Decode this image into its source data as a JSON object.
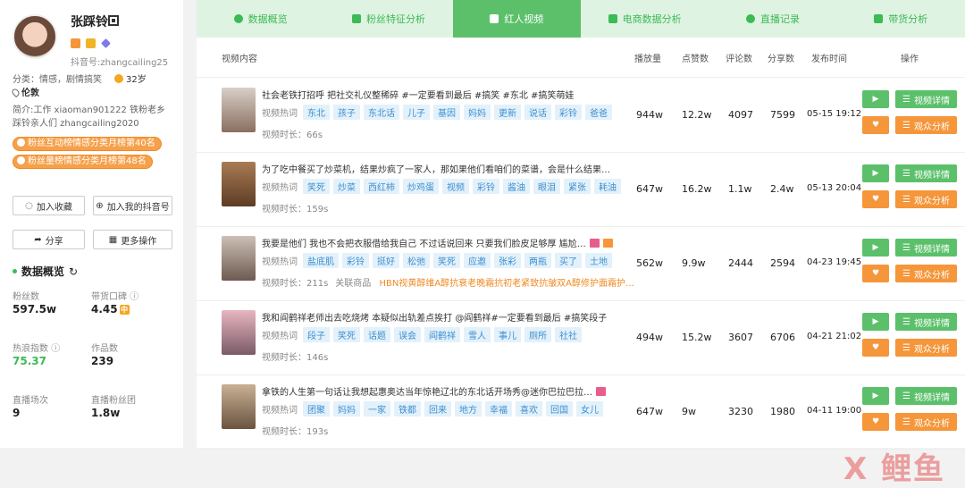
{
  "profile": {
    "name": "张踩铃",
    "douyin_id": "抖音号:zhangcailing25",
    "category": "分类：情感，剧情搞笑",
    "age": "32岁",
    "location": "伦敦",
    "intro": "简介:工作 xiaoman901222 铁粉老乡踩铃亲人们 zhangcailing2020",
    "ranks": [
      "粉丝互动榜情感分类月榜第40名",
      "粉丝量榜情感分类月榜第48名"
    ],
    "buttons": {
      "favorite": "加入收藏",
      "add_mine": "加入我的抖音号",
      "share": "分享",
      "more": "更多操作"
    }
  },
  "overview": {
    "title": "数据概览",
    "stats": [
      {
        "label": "粉丝数",
        "value": "597.5w"
      },
      {
        "label": "带货口碑",
        "value": "4.45",
        "badge": "中"
      },
      {
        "label": "热浪指数",
        "value": "75.37"
      },
      {
        "label": "作品数",
        "value": "239"
      },
      {
        "label": "直播场次",
        "value": "9"
      },
      {
        "label": "直播粉丝团",
        "value": "1.8w"
      }
    ]
  },
  "tabs": [
    "数据概览",
    "粉丝特征分析",
    "红人视频",
    "电商数据分析",
    "直播记录",
    "带货分析"
  ],
  "active_tab": 2,
  "table": {
    "headers": {
      "content": "视频内容",
      "plays": "播放量",
      "likes": "点赞数",
      "comments": "评论数",
      "shares": "分享数",
      "date": "发布时间",
      "ops": "操作"
    },
    "tag_label": "视频热词",
    "duration_label": "视频时长：",
    "detail_label": "视频详情",
    "audience_label": "观众分析",
    "rows": [
      {
        "title": "社会老铁打招呼 把社交礼仪整稀碎 #一定要看到最后 #搞笑 #东北 #搞笑萌娃",
        "tags": [
          "东北",
          "孩子",
          "东北话",
          "儿子",
          "基因",
          "妈妈",
          "更新",
          "说话",
          "彩铃",
          "爸爸"
        ],
        "duration": "66s",
        "goods": "",
        "plays": "944w",
        "likes": "12.2w",
        "comments": "4097",
        "shares": "7599",
        "date": "05-15 19:12"
      },
      {
        "title": "为了吃中餐买了炒菜机，结果炒疯了一家人，那如果他们看咱们的菜谱，会是什么结果…",
        "tags": [
          "笑死",
          "炒菜",
          "西红柿",
          "炒鸡蛋",
          "视频",
          "彩铃",
          "酱油",
          "眼泪",
          "紧张",
          "耗油"
        ],
        "duration": "159s",
        "goods": "",
        "plays": "647w",
        "likes": "16.2w",
        "comments": "1.1w",
        "shares": "2.4w",
        "date": "05-13 20:04"
      },
      {
        "title": "我要是他们 我也不会把衣服借给我自己 不过话说回来 只要我们脸皮足够厚 尴尬…",
        "tags": [
          "盐底肌",
          "彩铃",
          "挺好",
          "松弛",
          "笑死",
          "应邀",
          "张彩",
          "两瓶",
          "买了",
          "土地"
        ],
        "duration": "211s",
        "goods_label": "关联商品",
        "goods": "HBN视黄醇维A醇抗衰老晚霜抗初老紧致抗皱双A醇修护面霜护…",
        "plays": "562w",
        "likes": "9.9w",
        "comments": "2444",
        "shares": "2594",
        "date": "04-23 19:45"
      },
      {
        "title": "我和阎鹤祥老师出去吃烧烤 本疑似出轨差点挨打 @阎鹤祥#一定要看到最后 #搞笑段子",
        "tags": [
          "段子",
          "笑死",
          "话题",
          "误会",
          "阎鹤祥",
          "雪人",
          "事儿",
          "厕所",
          "社社"
        ],
        "duration": "146s",
        "goods": "",
        "plays": "494w",
        "likes": "15.2w",
        "comments": "3607",
        "shares": "6706",
        "date": "04-21 21:02"
      },
      {
        "title": "拿铁的人生第一句话让我想起惠奥达当年惊艳辽北的东北话开场秀@迷你巴拉巴拉…",
        "tags": [
          "团聚",
          "妈妈",
          "一家",
          "铁都",
          "回来",
          "地方",
          "幸福",
          "喜欢",
          "回国",
          "女儿"
        ],
        "duration": "193s",
        "goods": "",
        "plays": "647w",
        "likes": "9w",
        "comments": "3230",
        "shares": "1980",
        "date": "04-11 19:00"
      }
    ]
  },
  "watermark": "X 鲤鱼",
  "colors": {
    "green": "#5cc06b",
    "orange": "#f5963a",
    "tag_blue": "#3d8fcf"
  }
}
